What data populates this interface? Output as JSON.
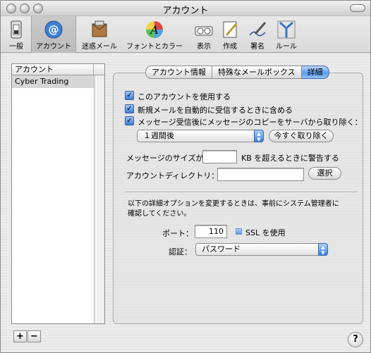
{
  "window": {
    "title": "アカウント"
  },
  "toolbar": {
    "items": [
      {
        "label": "一般",
        "icon": "general-switch-icon"
      },
      {
        "label": "アカウント",
        "icon": "at-sign-icon"
      },
      {
        "label": "迷惑メール",
        "icon": "junk-mail-icon"
      },
      {
        "label": "フォントとカラー",
        "icon": "fonts-colors-icon"
      },
      {
        "label": "表示",
        "icon": "viewing-glasses-icon"
      },
      {
        "label": "作成",
        "icon": "compose-pencil-icon"
      },
      {
        "label": "署名",
        "icon": "signature-pen-icon"
      },
      {
        "label": "ルール",
        "icon": "rules-arrows-icon"
      }
    ],
    "selected": "アカウント"
  },
  "accounts": {
    "header": "アカウント",
    "items": [
      "Cyber Trading"
    ]
  },
  "list_controls": {
    "add": "+",
    "remove": "−"
  },
  "tabs": [
    "アカウント情報",
    "特殊なメールボックス",
    "詳細"
  ],
  "active_tab": "詳細",
  "advanced": {
    "enable_account": {
      "label": "このアカウントを使用する",
      "checked": true
    },
    "include_new_mail": {
      "label": "新規メールを自動的に受信するときに含める",
      "checked": true
    },
    "remove_copy": {
      "label": "メッセージ受信後にメッセージのコピーをサーバから取り除く：",
      "checked": true
    },
    "remove_after": "１週間後",
    "remove_now_button": "今すぐ取り除く",
    "message_size_label": "メッセージのサイズが",
    "message_size_value": "",
    "message_size_suffix": "KB を超えるときに警告する",
    "account_dir_label": "アカウントディレクトリ：",
    "account_dir_value": "",
    "select_button": "選択",
    "notice": "以下の詳細オプションを変更するときは、事前にシステム管理者に確認してください。",
    "port_label": "ポート：",
    "port_value": "110",
    "ssl_label": "SSL を使用",
    "auth_label": "認証：",
    "auth_value": "パスワード"
  },
  "help_button": "?"
}
